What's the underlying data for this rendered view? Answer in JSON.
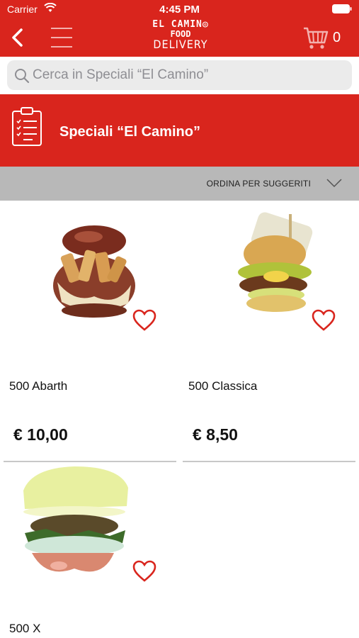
{
  "status": {
    "carrier": "Carrier",
    "time": "4:45 PM"
  },
  "header": {
    "logo": {
      "line1": "EL CAMIN◎",
      "line2": "FOOD",
      "line3": "DELIVERY"
    },
    "cart_count": "0"
  },
  "search": {
    "placeholder": "Cerca in Speciali “El Camino”"
  },
  "category": {
    "title": "Speciali “El Camino”"
  },
  "sort": {
    "label": "ORDINA PER SUGGERITI"
  },
  "products": [
    {
      "name": "500 Abarth",
      "price": "€ 10,00"
    },
    {
      "name": "500 Classica",
      "price": "€ 8,50"
    },
    {
      "name": "500 X",
      "price": ""
    }
  ],
  "colors": {
    "brand_red": "#d9251d",
    "sort_bar": "#b8b8b8",
    "search_bg": "#ebebeb"
  }
}
